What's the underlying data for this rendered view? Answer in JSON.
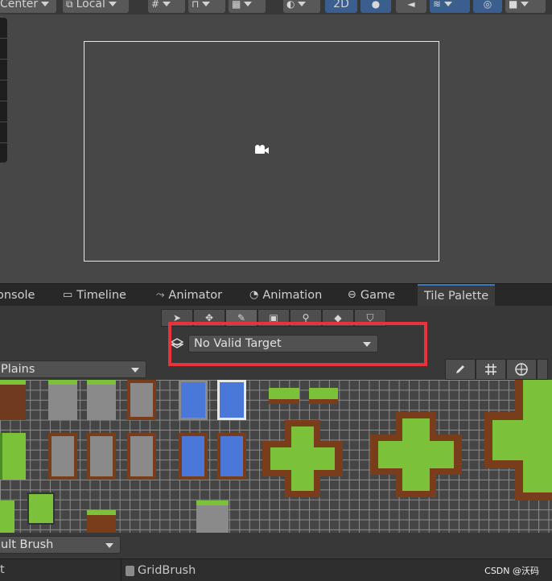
{
  "toolbar": {
    "pivot_label": "Center",
    "space_label": "Local",
    "mode_2d_label": "2D"
  },
  "tabs": [
    {
      "label": "onsole"
    },
    {
      "label": "Timeline"
    },
    {
      "label": "Animator"
    },
    {
      "label": "Animation"
    },
    {
      "label": "Game"
    },
    {
      "label": "Tile Palette"
    }
  ],
  "tile_palette": {
    "active_target": "No Valid Target",
    "palette_name": "Plains",
    "brush_name": "ult Brush",
    "bottom_left": "t",
    "bottom_brush": "GridBrush"
  },
  "colors": {
    "highlight": "#e8323c",
    "active_tab_accent": "#3a79bb",
    "mode_button": "#3a5f8f"
  },
  "watermark": "CSDN @沃码"
}
